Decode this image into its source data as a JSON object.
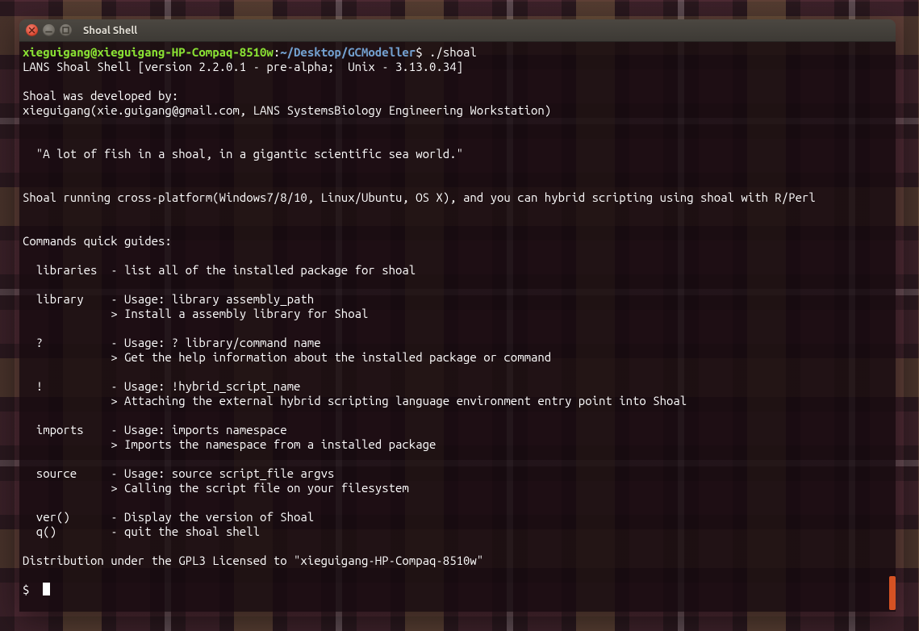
{
  "window": {
    "title": "Shoal Shell"
  },
  "prompt": {
    "userhost": "xieguigang@xieguigang-HP-Compaq-8510w",
    "sep1": ":",
    "path": "~/Desktop/GCModeller",
    "sep2": "$ ",
    "command": "./shoal"
  },
  "banner": {
    "line_version": "LANS Shoal Shell [version 2.2.0.1 - pre-alpha;  Unix - 3.13.0.34]",
    "line_devby": "Shoal was developed by:",
    "line_author": "xieguigang(xie.guigang@gmail.com, LANS SystemsBiology Engineering Workstation)",
    "line_quote": "  \"A lot of fish in a shoal, in a gigantic scientific sea world.\"",
    "line_crossplat": "Shoal running cross-platform(Windows7/8/10, Linux/Ubuntu, OS X), and you can hybrid scripting using shoal with R/Perl",
    "line_guides_hdr": "Commands quick guides:"
  },
  "guides": {
    "libraries": "  libraries  - list all of the installed package for shoal",
    "library1": "  library    - Usage: library assembly_path",
    "library2": "             > Install a assembly library for Shoal",
    "q1": "  ?          - Usage: ? library/command name",
    "q2": "             > Get the help information about the installed package or command",
    "bang1": "  !          - Usage: !hybrid_script_name",
    "bang2": "             > Attaching the external hybrid scripting language environment entry point into Shoal",
    "imports1": "  imports    - Usage: imports namespace",
    "imports2": "             > Imports the namespace from a installed package",
    "source1": "  source     - Usage: source script_file argvs",
    "source2": "             > Calling the script file on your filesystem",
    "ver": "  ver()      - Display the version of Shoal",
    "quit": "  q()        - quit the shoal shell"
  },
  "footer": {
    "dist": "Distribution under the GPL3 Licensed to \"xieguigang-HP-Compaq-8510w\""
  },
  "shell_prompt": {
    "symbol": "$  "
  }
}
